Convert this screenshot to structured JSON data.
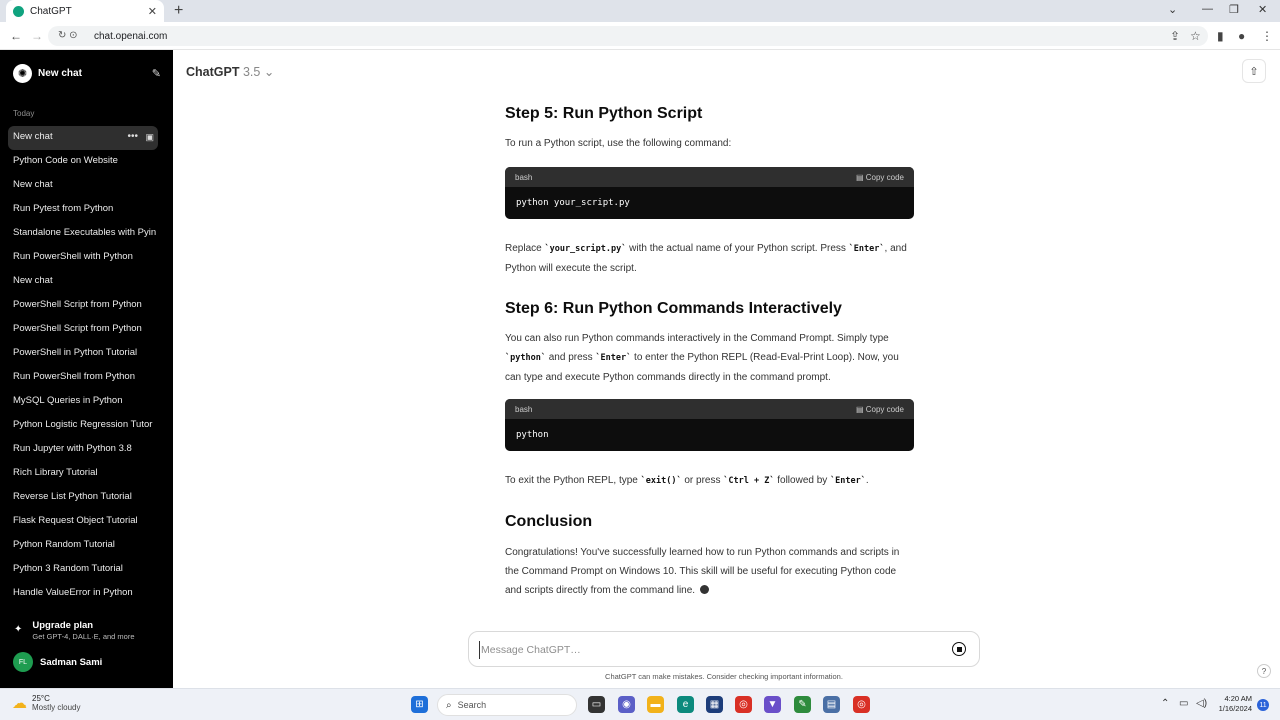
{
  "browser": {
    "tab_title": "ChatGPT",
    "url": "chat.openai.com"
  },
  "sidebar": {
    "new_chat_label": "New chat",
    "section_label": "Today",
    "items": [
      {
        "label": "New chat"
      },
      {
        "label": "Python Code on Website"
      },
      {
        "label": "New chat"
      },
      {
        "label": "Run Pytest from Python"
      },
      {
        "label": "Standalone Executables with Pyin"
      },
      {
        "label": "Run PowerShell with Python"
      },
      {
        "label": "New chat"
      },
      {
        "label": "PowerShell Script from Python"
      },
      {
        "label": "PowerShell Script from Python"
      },
      {
        "label": "PowerShell in Python Tutorial"
      },
      {
        "label": "Run PowerShell from Python"
      },
      {
        "label": "MySQL Queries in Python"
      },
      {
        "label": "Python Logistic Regression Tutor"
      },
      {
        "label": "Run Jupyter with Python 3.8"
      },
      {
        "label": "Rich Library Tutorial"
      },
      {
        "label": "Reverse List Python Tutorial"
      },
      {
        "label": "Flask Request Object Tutorial"
      },
      {
        "label": "Python Random Tutorial"
      },
      {
        "label": "Python 3 Random Tutorial"
      },
      {
        "label": "Handle ValueError in Python"
      }
    ],
    "upgrade_title": "Upgrade plan",
    "upgrade_subtitle": "Get GPT-4, DALL·E, and more",
    "user_initials": "FL",
    "user_name": "Sadman Sami"
  },
  "header": {
    "model_name": "ChatGPT",
    "model_version": "3.5"
  },
  "content": {
    "step5_heading": "Step 5: Run Python Script",
    "step5_intro": "To run a Python script, use the following command:",
    "code1_lang": "bash",
    "code1_copy": "Copy code",
    "code1_code": "python your_script.py",
    "replace_p1": "Replace ",
    "replace_code1": "`your_script.py`",
    "replace_p2": " with the actual name of your Python script. Press ",
    "replace_code2": "`Enter`",
    "replace_p3": ", and Python will execute the script.",
    "step6_heading": "Step 6: Run Python Commands Interactively",
    "step6_p1": "You can also run Python commands interactively in the Command Prompt. Simply type ",
    "step6_code1": "`python`",
    "step6_p2": " and press ",
    "step6_code2": "`Enter`",
    "step6_p3": " to enter the Python REPL (Read-Eval-Print Loop). Now, you can type and execute Python commands directly in the command prompt.",
    "code2_lang": "bash",
    "code2_copy": "Copy code",
    "code2_code": "python",
    "exit_p1": "To exit the Python REPL, type ",
    "exit_code1": "`exit()`",
    "exit_p2": " or press ",
    "exit_code2": "`Ctrl + Z`",
    "exit_p3": " followed by ",
    "exit_code3": "`Enter`",
    "exit_p4": ".",
    "conclusion_heading": "Conclusion",
    "conclusion_text": "Congratulations! You've successfully learned how to run Python commands and scripts in the Command Prompt on Windows 10. This skill will be useful for executing Python code and scripts directly from the command line."
  },
  "composer": {
    "placeholder": "Message ChatGPT…",
    "disclaimer": "ChatGPT can make mistakes. Consider checking important information."
  },
  "taskbar": {
    "temperature": "25°C",
    "weather": "Mostly cloudy",
    "search_label": "Search",
    "time": "4:20 AM",
    "date": "1/16/2024",
    "notification_count": "11"
  }
}
